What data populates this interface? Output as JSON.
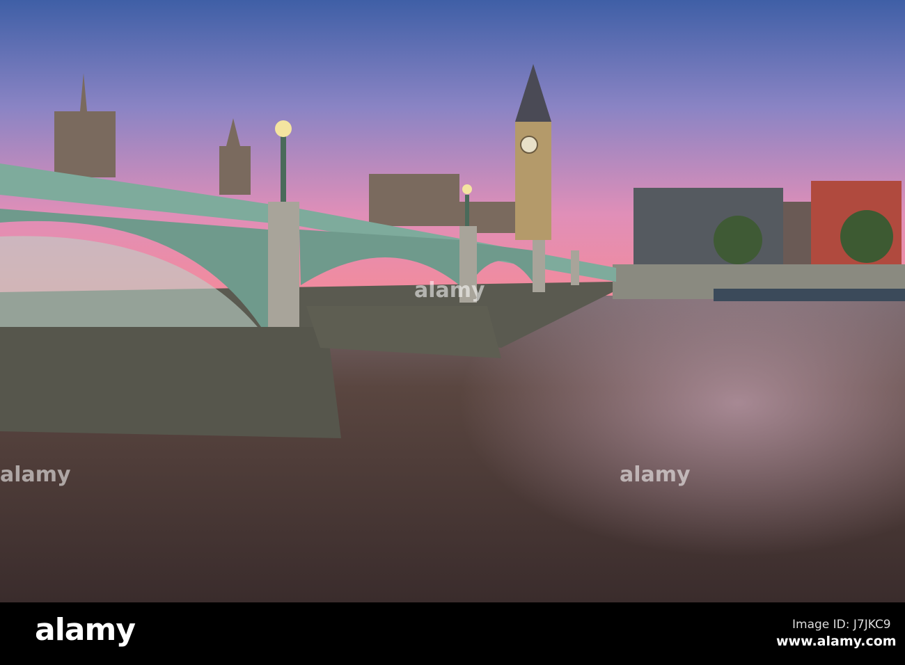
{
  "photo": {
    "subject": "Westminster Bridge and Big Ben at dusk",
    "colors": {
      "sky_top": "#4f69ad",
      "sky_horizon": "#f08aa0",
      "water": "#4b3a36",
      "bridge": "#7eab9c"
    }
  },
  "watermark": {
    "logo_text": "alamy",
    "overlay_text": "alamy"
  },
  "footer": {
    "logo": "alamy",
    "image_id": "Image ID: J7JKC9",
    "url": "www.alamy.com"
  }
}
